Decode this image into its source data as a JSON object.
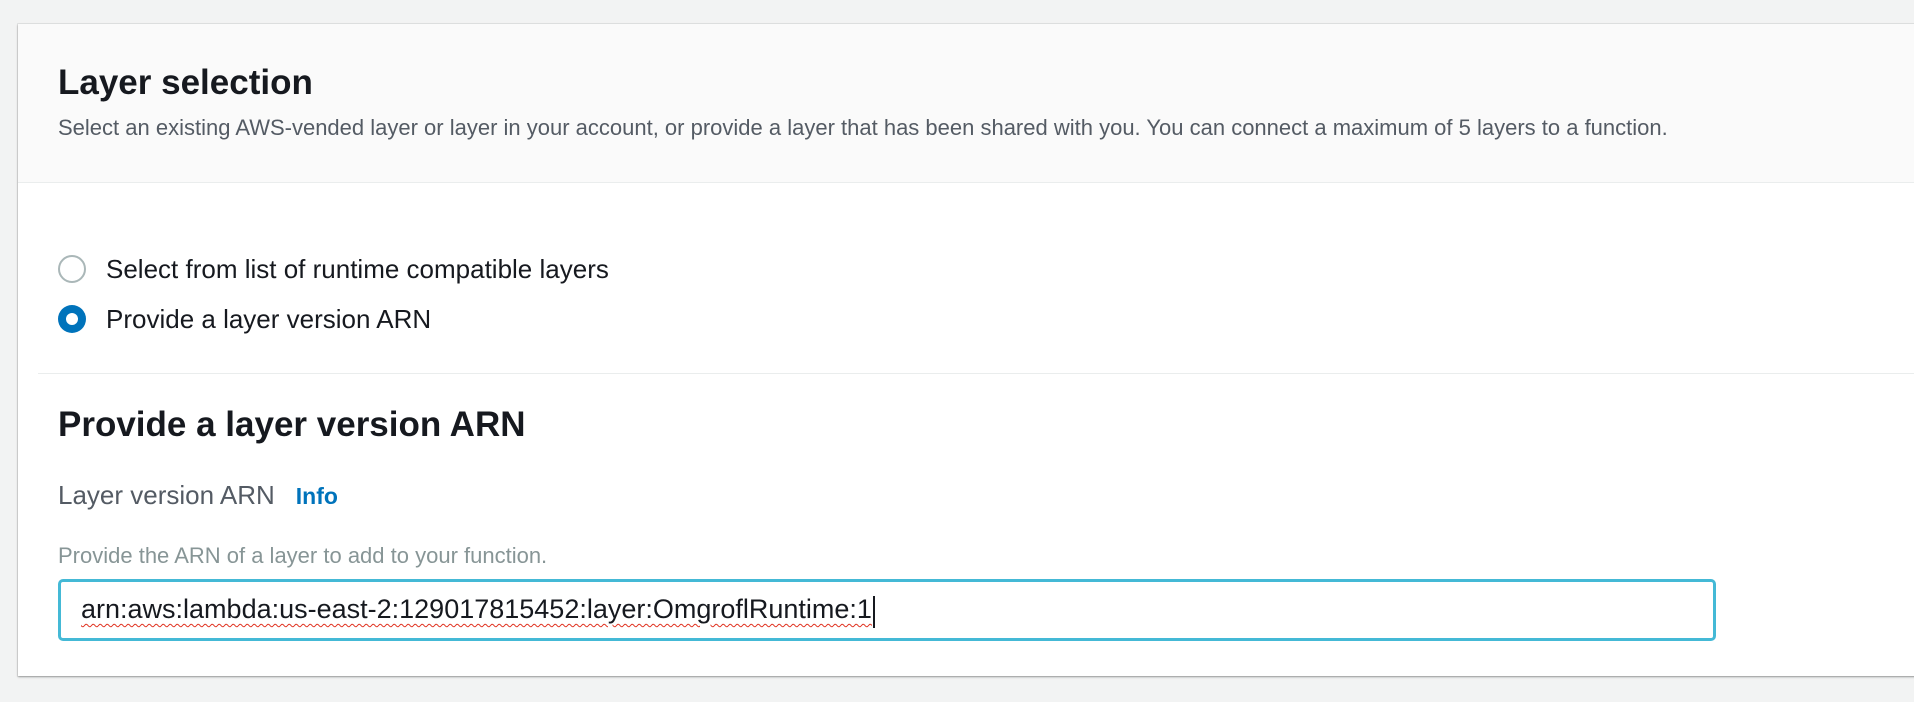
{
  "layer_selection": {
    "title": "Layer selection",
    "description": "Select an existing AWS-vended layer or layer in your account, or provide a layer that has been shared with you. You can connect a maximum of 5 layers to a function."
  },
  "source_options": {
    "selected_index": 1,
    "items": [
      {
        "label": "Select from list of runtime compatible layers",
        "checked": false
      },
      {
        "label": "Provide a layer version ARN",
        "checked": true
      }
    ]
  },
  "arn_section": {
    "title": "Provide a layer version ARN",
    "field_label": "Layer version ARN",
    "info_link": "Info",
    "field_description": "Provide the ARN of a layer to add to your function.",
    "input_value": "arn:aws:lambda:us-east-2:129017815452:layer:OmgroflRuntime:1"
  },
  "colors": {
    "accent": "#0073bb",
    "focus_border": "#44b9d6",
    "spellcheck_underline": "#e0301e"
  }
}
